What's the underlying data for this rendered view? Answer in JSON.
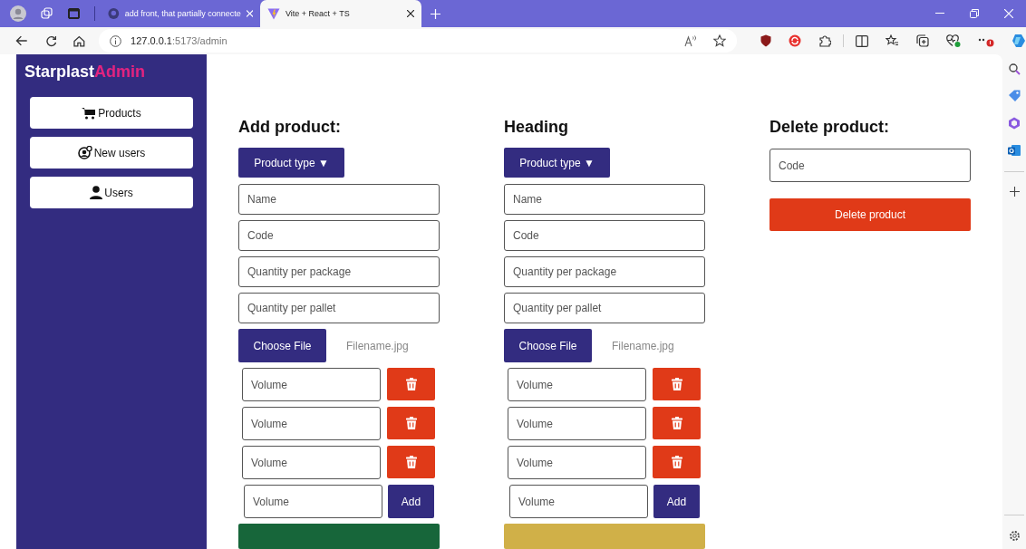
{
  "browser": {
    "tabs": [
      {
        "title": "add front, that partially connecte",
        "kind": "repo",
        "selected": false
      },
      {
        "title": "Vite + React + TS",
        "kind": "app",
        "selected": true
      }
    ],
    "url_host": "127.0.0.1",
    "url_path": ":5173/admin"
  },
  "sidebar": {
    "brand": "Starplast",
    "brand_accent": "Admin",
    "items": [
      {
        "label": "Products",
        "kind": "cart"
      },
      {
        "label": "New users",
        "kind": "user-add"
      },
      {
        "label": "Users",
        "kind": "user"
      }
    ]
  },
  "forms": [
    {
      "heading": "Add product:",
      "dropdown": "Product type ▼",
      "fields": [
        {
          "placeholder": "Name"
        },
        {
          "placeholder": "Code"
        },
        {
          "placeholder": "Quantity per package"
        },
        {
          "placeholder": "Quantity per pallet"
        }
      ],
      "file_button": "Choose File",
      "filename": "Filename.jpg",
      "volumes": [
        {
          "placeholder": "Volume",
          "kind": "delete"
        },
        {
          "placeholder": "Volume",
          "kind": "delete"
        },
        {
          "placeholder": "Volume",
          "kind": "delete"
        },
        {
          "placeholder": "Volume",
          "kind": "add",
          "button": "Add"
        }
      ],
      "submit": {
        "color": "#17663a"
      }
    },
    {
      "heading": "Heading",
      "dropdown": "Product type ▼",
      "fields": [
        {
          "placeholder": "Name"
        },
        {
          "placeholder": "Code"
        },
        {
          "placeholder": "Quantity per package"
        },
        {
          "placeholder": "Quantity per pallet"
        }
      ],
      "file_button": "Choose File",
      "filename": "Filename.jpg",
      "volumes": [
        {
          "placeholder": "Volume",
          "kind": "delete"
        },
        {
          "placeholder": "Volume",
          "kind": "delete"
        },
        {
          "placeholder": "Volume",
          "kind": "delete"
        },
        {
          "placeholder": "Volume",
          "kind": "add",
          "button": "Add"
        }
      ],
      "submit": {
        "color": "#d0b048"
      }
    }
  ],
  "delete_form": {
    "heading": "Delete product:",
    "field": {
      "placeholder": "Code"
    },
    "button": "Delete product"
  }
}
